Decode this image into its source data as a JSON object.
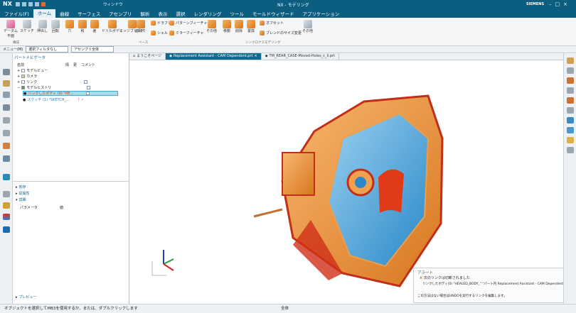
{
  "app": {
    "logo": "NX",
    "title": "NX - モデリング",
    "brand": "SIEMENS",
    "search_placeholder": "ウィンドウ"
  },
  "menu": [
    "ファイル(F)",
    "ホーム",
    "曲線",
    "サーフェス",
    "アセンブリ",
    "解析",
    "表示",
    "選択",
    "レンダリング",
    "ツール",
    "モールドウィザード",
    "アプリケーション"
  ],
  "ribbon": {
    "buttons": [
      "データム平面",
      "スケッチ",
      "押出し",
      "回転",
      "穴",
      "和",
      "差",
      "ドリルボディ",
      "エッジブレンド",
      "面取り",
      "シェル",
      "ドラフト",
      "パターンフィーチャ",
      "ミラーフィーチャ",
      "その他",
      "移動",
      "削除",
      "置換",
      "オフセット",
      "ブレンドのサイズ変更",
      "その他"
    ],
    "group_labels": [
      "構成",
      "ベース",
      "シンクロナスモデリング"
    ]
  },
  "toolbar2": {
    "menu_label": "メニュー(M)",
    "filter": "選択フィルタなし",
    "scope": "アセンブリ全体"
  },
  "nav": {
    "title": "パートナビゲータ",
    "columns": [
      "名前",
      "情",
      "更",
      "コメント"
    ],
    "tree": [
      "モデルビュー",
      "カメラ",
      "リンク",
      "モデルヒストリ",
      "リンクしたボディ (0) \"HE...",
      "スケッチ (1) \"SKETCH_..."
    ],
    "sections": [
      "依存",
      "従属性",
      "詳細",
      "プレビュー"
    ],
    "detail_columns": [
      "パラメータ",
      "値"
    ]
  },
  "tabs": [
    "ようこそページ",
    "Replacement Assistant - CAM Dependent.prt",
    "TM_REAR_CASE-Moved-Holes_c_li.prt"
  ],
  "alert": {
    "title": "アラート",
    "line1": "次のリンクは切断されました",
    "line2": "リンクしたボディ(0) \"HEALED_BODY_\" \"パート内 Replacement Assistant - CAM Dependent",
    "line3": "この方法はない場合はUNDOを実行するリンクを編集します。"
  },
  "status": {
    "left": "オブジェクトを選択してMB3を使用するか、または、ダブルクリックします",
    "center": "全体"
  }
}
